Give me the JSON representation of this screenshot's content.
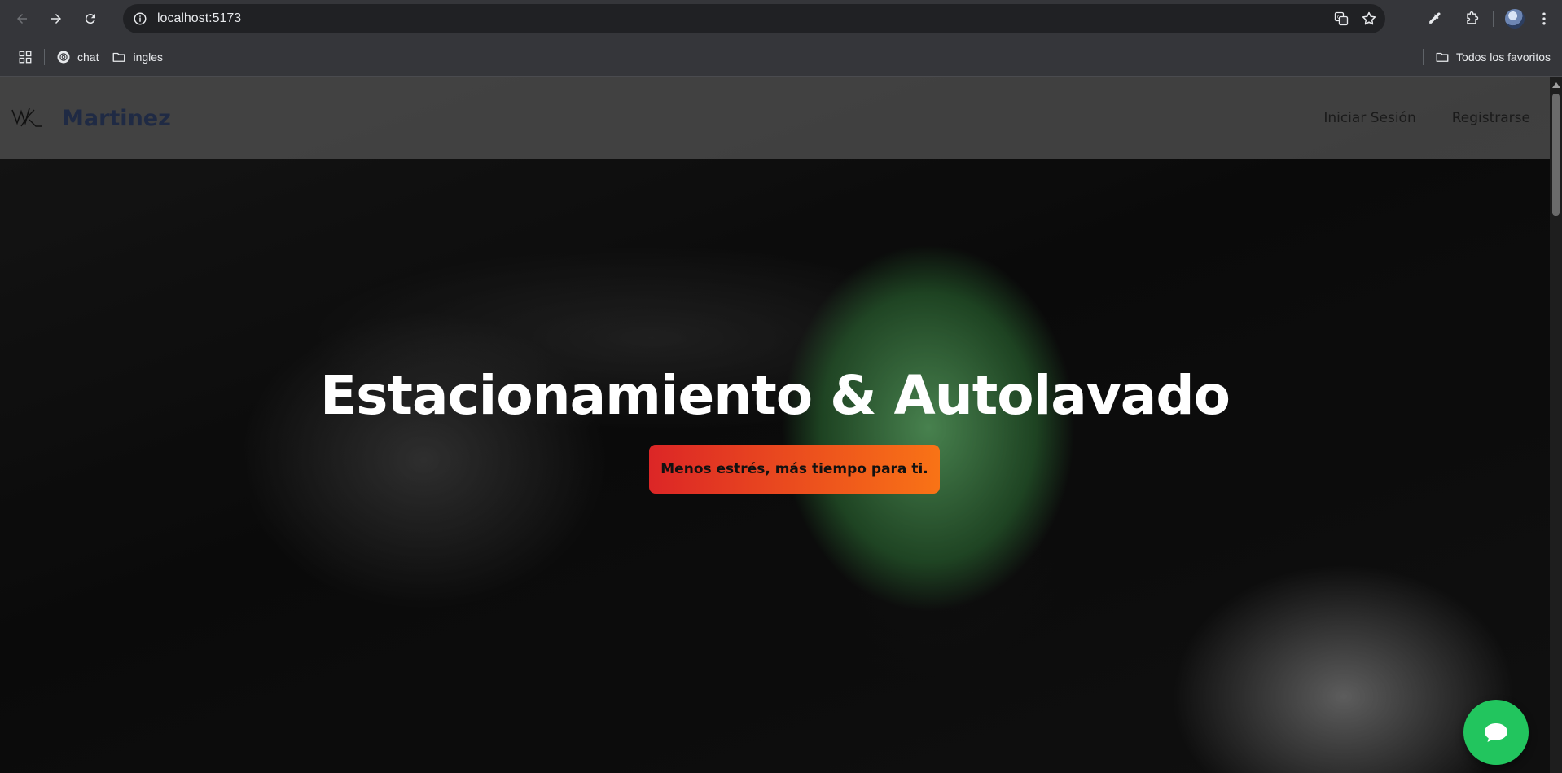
{
  "browser": {
    "url": "localhost:5173",
    "bookmarks": [
      {
        "label": "chat",
        "icon": "chatgpt-icon"
      },
      {
        "label": "ingles",
        "icon": "folder-icon"
      }
    ],
    "all_bookmarks_label": "Todos los favoritos"
  },
  "site": {
    "brand": "Martinez",
    "nav": {
      "login": "Iniciar Sesión",
      "register": "Registrarse"
    },
    "hero": {
      "title": "Estacionamiento & Autolavado",
      "tagline": "Menos estrés, más tiempo para ti."
    },
    "colors": {
      "badge_start": "#dc2626",
      "badge_end": "#f97316",
      "chat_fab": "#22c55e",
      "brand": "#1f2a44"
    }
  }
}
